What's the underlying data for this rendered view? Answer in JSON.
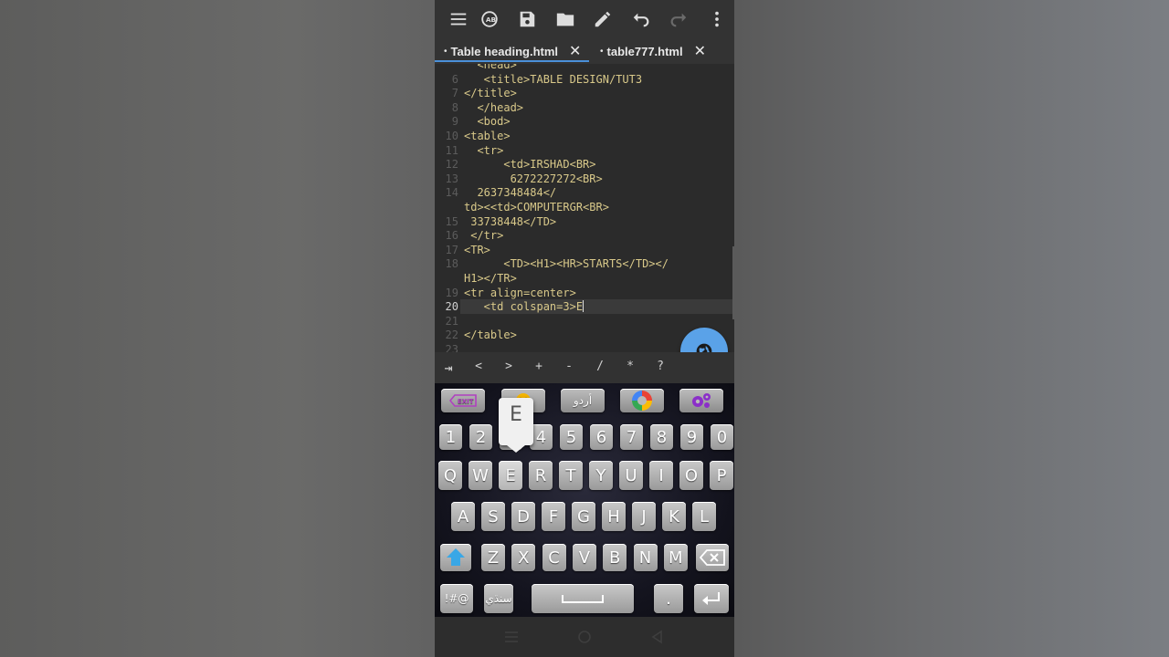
{
  "toolbar": {
    "icons": [
      "menu-icon",
      "spellcheck-icon",
      "save-icon",
      "folder-icon",
      "edit-icon",
      "undo-icon",
      "redo-icon",
      "more-vert-icon"
    ]
  },
  "tabs": [
    {
      "dot": "•",
      "label": "Table heading.html",
      "close": "✕"
    },
    {
      "dot": "•",
      "label": "table777.html",
      "close": "✕"
    }
  ],
  "editor": {
    "lines": [
      {
        "num": "",
        "text": "  <head>"
      },
      {
        "num": "6",
        "text": "   <title>TABLE DESIGN/TUT3"
      },
      {
        "num": "7",
        "text": "</title>"
      },
      {
        "num": "8",
        "text": "  </head>"
      },
      {
        "num": "9",
        "text": "  <bod>"
      },
      {
        "num": "10",
        "text": "<table>"
      },
      {
        "num": "11",
        "text": "  <tr>"
      },
      {
        "num": "12",
        "text": "      <td>IRSHAD<BR>"
      },
      {
        "num": "13",
        "text": "       6272227272<BR>"
      },
      {
        "num": "14",
        "text": "  2637348484</"
      },
      {
        "num": "",
        "text": "td><<td>COMPUTERGR<BR>"
      },
      {
        "num": "15",
        "text": " 33738448</TD>"
      },
      {
        "num": "16",
        "text": " </tr>"
      },
      {
        "num": "17",
        "text": "<TR>"
      },
      {
        "num": "18",
        "text": "      <TD><H1><HR>STARTS</TD></"
      },
      {
        "num": "",
        "text": "H1></TR>"
      },
      {
        "num": "19",
        "text": "<tr align=center>"
      },
      {
        "num": "20",
        "text": "   <td colspan=3>E"
      },
      {
        "num": "21",
        "text": ""
      },
      {
        "num": "22",
        "text": "</table>"
      },
      {
        "num": "23",
        "text": ""
      }
    ]
  },
  "symbols": [
    "⇥",
    "<",
    ">",
    "+",
    "-",
    "/",
    "*",
    "?"
  ],
  "keyboard": {
    "tool_row": {
      "arabic_label": "أردو"
    },
    "number_row": [
      "1",
      "2",
      "3",
      "4",
      "5",
      "6",
      "7",
      "8",
      "9",
      "0"
    ],
    "row1": [
      "Q",
      "W",
      "E",
      "R",
      "T",
      "Y",
      "U",
      "I",
      "O",
      "P"
    ],
    "row2": [
      "A",
      "S",
      "D",
      "F",
      "G",
      "H",
      "J",
      "K",
      "L"
    ],
    "row3": [
      "Z",
      "X",
      "C",
      "V",
      "B",
      "N",
      "M"
    ],
    "symbols_key": "!#@",
    "lang_key": "سنڌي",
    "period_key": ".",
    "popup_letter": "E"
  },
  "colors": {
    "editor_bg": "#2b2b2b",
    "code_text": "#d9c98a",
    "accent": "#4a90d9",
    "fab": "#5aa2e8"
  }
}
